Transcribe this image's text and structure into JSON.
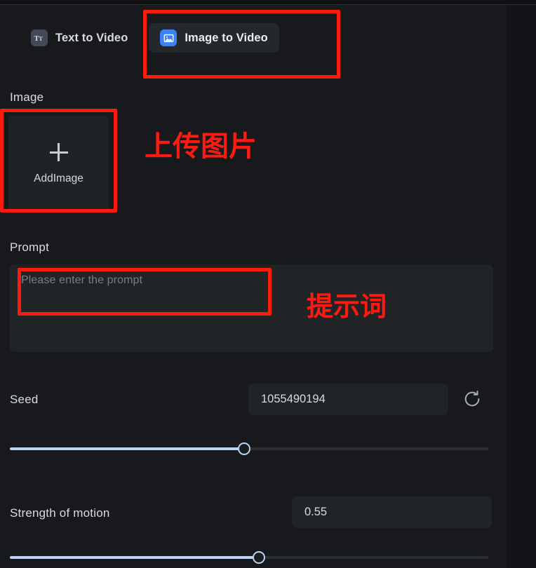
{
  "app": {
    "panel_bg": "#17191c",
    "accent": "#3b82f6",
    "slider_color": "#b7d4f2",
    "annotation_color": "#ff1a10"
  },
  "tabs": [
    {
      "id": "text-to-video",
      "label": "Text to Video",
      "icon": "text-format-icon",
      "icon_glyph": "Tт",
      "active": false
    },
    {
      "id": "image-to-video",
      "label": "Image to Video",
      "icon": "picture-icon",
      "active": true
    }
  ],
  "image_section": {
    "label": "Image",
    "add_button": {
      "caption": "AddImage",
      "icon": "plus-icon"
    }
  },
  "prompt_section": {
    "label": "Prompt",
    "placeholder": "Please enter the prompt",
    "value": ""
  },
  "seed_section": {
    "label": "Seed",
    "value": "1055490194",
    "refresh_icon": "refresh-icon",
    "slider_percent": 49
  },
  "motion_section": {
    "label": "Strength of motion",
    "value": "0.55",
    "slider_percent": 52
  },
  "annotations": [
    {
      "id": "anno-upload-image",
      "text": "上传图片"
    },
    {
      "id": "anno-prompt",
      "text": "提示词"
    }
  ]
}
